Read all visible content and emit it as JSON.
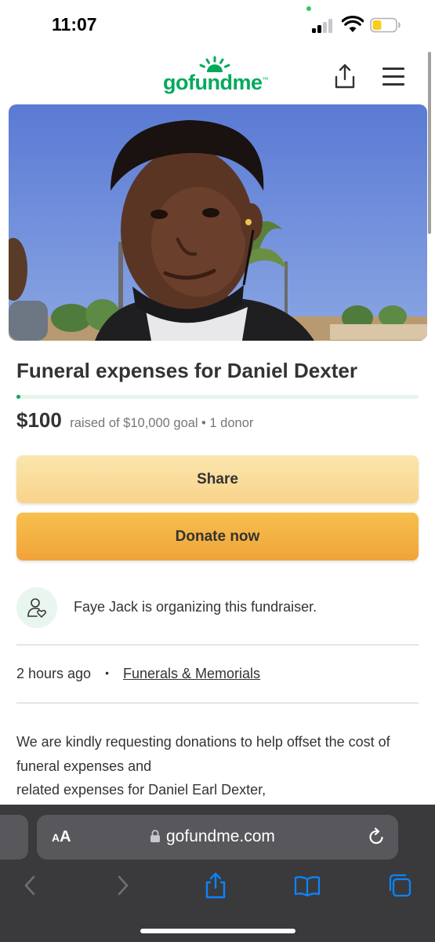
{
  "status_bar": {
    "time": "11:07"
  },
  "header": {
    "logo_text": "gofundme",
    "logo_trademark": "™"
  },
  "campaign": {
    "title": "Funeral expenses for Daniel Dexter",
    "raised": "$100",
    "goal_text": "raised of $10,000 goal",
    "donor_text": "1 donor",
    "progress_fraction": 0.01
  },
  "buttons": {
    "share_label": "Share",
    "donate_label": "Donate now"
  },
  "organizer": {
    "text": "Faye Jack is organizing this fundraiser."
  },
  "meta": {
    "created": "2 hours ago",
    "separator": "•",
    "category": "Funerals & Memorials"
  },
  "story": {
    "lines": [
      "We are kindly requesting donations to help offset the cost of funeral expenses and",
      "related expenses for Daniel Earl Dexter,"
    ]
  },
  "browser": {
    "text_size_small": "A",
    "text_size_big": "A",
    "domain": "gofundme.com"
  },
  "colors": {
    "brand_green": "#02a95c",
    "share_button": "#f9d38b",
    "donate_button": "#f0a33a",
    "safari_toolbar": "#3a3a3c",
    "safari_icon_blue": "#0a84ff"
  },
  "icons": {
    "share": "share-icon",
    "menu": "hamburger-menu-icon",
    "organizer": "user-heart-icon",
    "lock": "lock-icon",
    "reload": "reload-icon",
    "back": "chevron-left-icon",
    "forward": "chevron-right-icon",
    "bookmarks": "book-icon",
    "tabs": "tabs-icon"
  }
}
